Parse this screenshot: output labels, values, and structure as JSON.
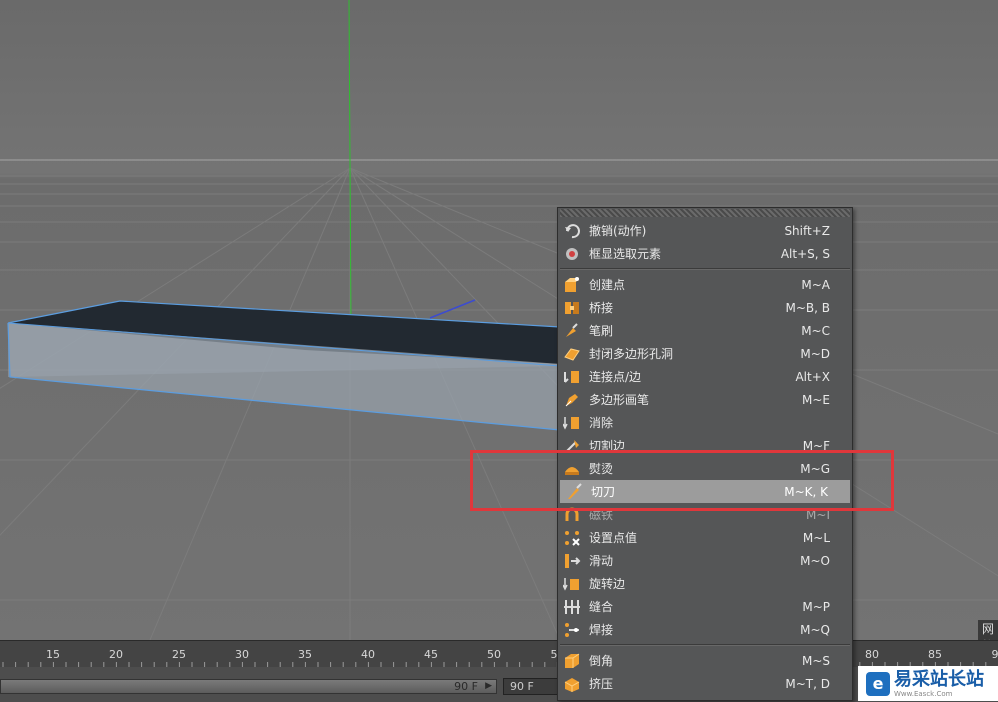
{
  "colors": {
    "viewport_bg": "#707070",
    "menu_bg": "#555657",
    "menu_highlight": "#9c9c9c",
    "annotation_red": "#e0373b",
    "object_top": "#222931",
    "y_axis": "#2fbf2f"
  },
  "menu": {
    "items": [
      {
        "label": "撤销(动作)",
        "shortcut": "Shift+Z",
        "icon": "undo-icon"
      },
      {
        "label": "框显选取元素",
        "shortcut": "Alt+S, S",
        "icon": "frame-selection-icon"
      },
      {
        "separator": true
      },
      {
        "label": "创建点",
        "shortcut": "M~A",
        "icon": "create-point-icon"
      },
      {
        "label": "桥接",
        "shortcut": "M~B, B",
        "icon": "bridge-icon"
      },
      {
        "label": "笔刷",
        "shortcut": "M~C",
        "icon": "brush-icon"
      },
      {
        "label": "封闭多边形孔洞",
        "shortcut": "M~D",
        "icon": "close-hole-icon"
      },
      {
        "label": "连接点/边",
        "shortcut": "Alt+X",
        "icon": "connect-icon"
      },
      {
        "label": "多边形画笔",
        "shortcut": "M~E",
        "icon": "polygon-pen-icon"
      },
      {
        "label": "消除",
        "shortcut": "",
        "icon": "dissolve-icon"
      },
      {
        "label": "切割边",
        "shortcut": "M~F",
        "icon": "edge-cut-icon"
      },
      {
        "label": "熨烫",
        "shortcut": "M~G",
        "icon": "iron-icon"
      },
      {
        "label": "切刀",
        "shortcut": "M~K, K",
        "icon": "knife-icon",
        "highlight": true
      },
      {
        "label": "磁铁",
        "shortcut": "M~I",
        "icon": "magnet-icon",
        "dim": true
      },
      {
        "label": "设置点值",
        "shortcut": "M~L",
        "icon": "set-point-value-icon"
      },
      {
        "label": "滑动",
        "shortcut": "M~O",
        "icon": "slide-icon"
      },
      {
        "label": "旋转边",
        "shortcut": "",
        "icon": "spin-edge-icon"
      },
      {
        "label": "缝合",
        "shortcut": "M~P",
        "icon": "stitch-icon"
      },
      {
        "label": "焊接",
        "shortcut": "M~Q",
        "icon": "weld-icon"
      },
      {
        "separator": true
      },
      {
        "label": "倒角",
        "shortcut": "M~S",
        "icon": "bevel-icon"
      },
      {
        "label": "挤压",
        "shortcut": "M~T, D",
        "icon": "extrude-icon"
      }
    ]
  },
  "timeline": {
    "ticks": [
      "15",
      "20",
      "25",
      "30",
      "35",
      "40",
      "45",
      "50",
      "5",
      "80",
      "85",
      "9"
    ],
    "frame_end_label": "90 F",
    "frame_field_value": "90 F"
  },
  "viewport": {
    "panel_label": "网格"
  },
  "watermark": {
    "name": "易采站长站",
    "sub": "Www.Easck.Com"
  }
}
